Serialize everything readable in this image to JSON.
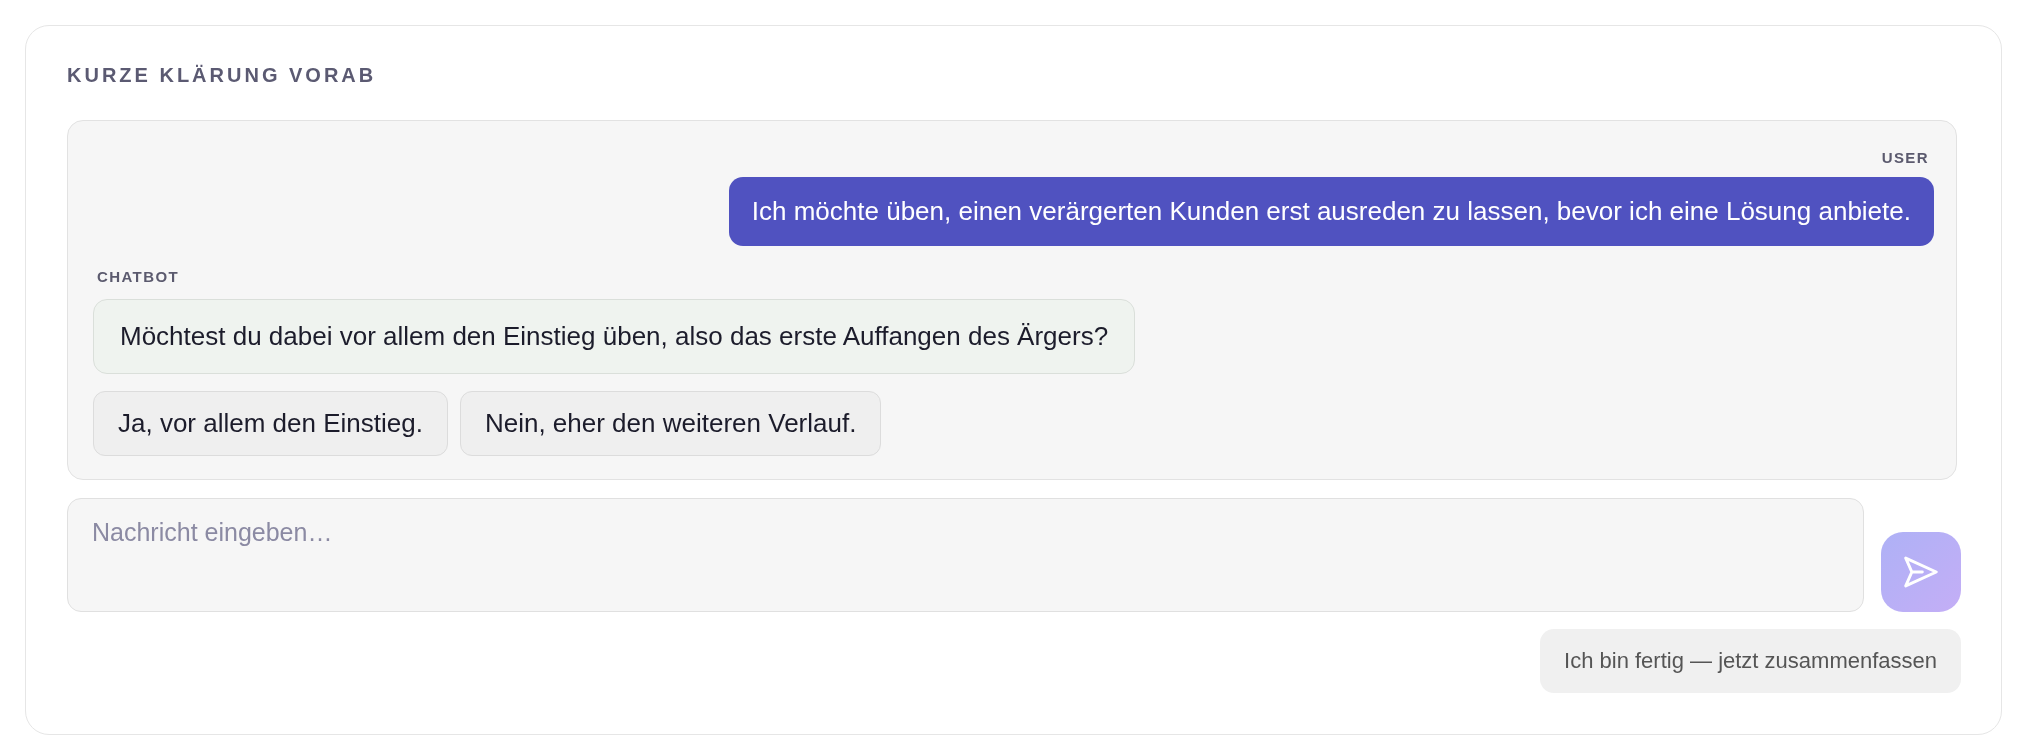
{
  "title": "KURZE KLÄRUNG VORAB",
  "messages": [
    {
      "kind": "user",
      "sender": "USER",
      "text": "Ich möchte üben, einen verärgerten Kunden erst ausreden zu lassen, bevor ich eine Lösung anbiete."
    },
    {
      "kind": "bot",
      "sender": "CHATBOT",
      "text": "Möchtest du dabei vor allem den Einstieg üben, also das erste Auffangen des Ärgers?",
      "options": [
        "Ja, vor allem den Einstieg.",
        "Nein, eher den weiteren Verlauf."
      ]
    }
  ],
  "composer": {
    "placeholder": "Nachricht eingeben…",
    "send_disabled": true
  },
  "finish_button": "Ich bin fertig — jetzt zusammenfassen"
}
